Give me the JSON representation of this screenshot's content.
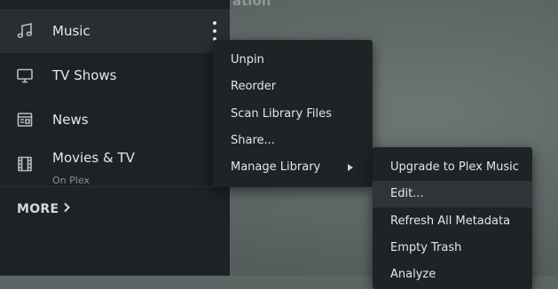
{
  "background": {
    "title_fragment": "ation"
  },
  "sidebar": {
    "items": [
      {
        "label": "Music",
        "icon": "music-note-icon"
      },
      {
        "label": "TV Shows",
        "icon": "monitor-icon"
      },
      {
        "label": "News",
        "icon": "newspaper-icon"
      },
      {
        "label": "Movies & TV",
        "sublabel": "On Plex",
        "icon": "film-icon"
      }
    ],
    "more_label": "MORE"
  },
  "context_menu": {
    "items": [
      "Unpin",
      "Reorder",
      "Scan Library Files",
      "Share...",
      "Manage Library"
    ]
  },
  "submenu": {
    "items": [
      "Upgrade to Plex Music",
      "Edit...",
      "Refresh All Metadata",
      "Empty Trash",
      "Analyze"
    ],
    "highlighted": "Edit..."
  },
  "colors": {
    "sidebar_bg": "#1e2125",
    "active_item_bg": "#2a2e33",
    "menu_bg": "#202326",
    "menu_hover_bg": "#303438",
    "text": "#e6e7e8"
  }
}
